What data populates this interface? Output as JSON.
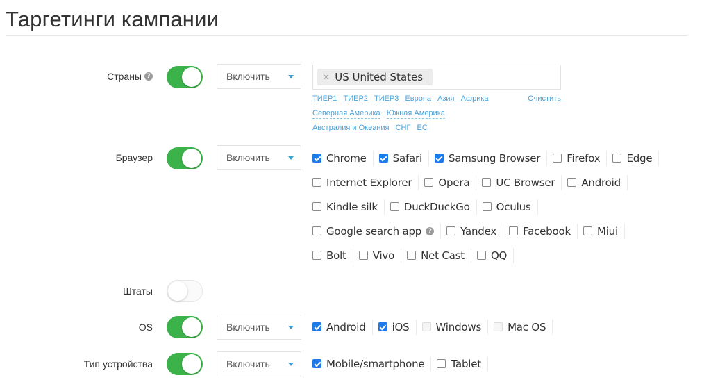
{
  "page": {
    "title": "Таргетинги кампании"
  },
  "countries": {
    "label": "Страны",
    "has_help": true,
    "toggle_on": true,
    "mode": "Включить",
    "selected_tags": [
      {
        "code": "US",
        "name": "US United States"
      }
    ],
    "quick_links": [
      [
        "ТИЕР1",
        "ТИЕР2",
        "ТИЕР3",
        "Европа",
        "Азия",
        "Африка"
      ],
      [
        "Северная Америка",
        "Южная Америка"
      ],
      [
        "Австралия и Океания",
        "СНГ",
        "ЕС"
      ]
    ],
    "clear_label": "Очистить"
  },
  "browser": {
    "label": "Браузер",
    "toggle_on": true,
    "mode": "Включить",
    "rows": [
      [
        {
          "label": "Chrome",
          "checked": true
        },
        {
          "label": "Safari",
          "checked": true
        },
        {
          "label": "Samsung Browser",
          "checked": true
        },
        {
          "label": "Firefox",
          "checked": false
        },
        {
          "label": "Edge",
          "checked": false
        }
      ],
      [
        {
          "label": "Internet Explorer",
          "checked": false
        },
        {
          "label": "Opera",
          "checked": false
        },
        {
          "label": "UC Browser",
          "checked": false
        },
        {
          "label": "Android",
          "checked": false
        }
      ],
      [
        {
          "label": "Kindle silk",
          "checked": false
        },
        {
          "label": "DuckDuckGo",
          "checked": false
        },
        {
          "label": "Oculus",
          "checked": false
        }
      ],
      [
        {
          "label": "Google search app",
          "checked": false,
          "help": true
        },
        {
          "label": "Yandex",
          "checked": false
        },
        {
          "label": "Facebook",
          "checked": false
        },
        {
          "label": "Miui",
          "checked": false
        }
      ],
      [
        {
          "label": "Bolt",
          "checked": false
        },
        {
          "label": "Vivo",
          "checked": false
        },
        {
          "label": "Net Cast",
          "checked": false
        },
        {
          "label": "QQ",
          "checked": false
        }
      ]
    ]
  },
  "states": {
    "label": "Штаты",
    "toggle_on": false
  },
  "os": {
    "label": "OS",
    "toggle_on": true,
    "mode": "Включить",
    "options": [
      {
        "label": "Android",
        "checked": true
      },
      {
        "label": "iOS",
        "checked": true
      },
      {
        "label": "Windows",
        "checked": false,
        "disabled": true
      },
      {
        "label": "Mac OS",
        "checked": false,
        "disabled": true
      }
    ]
  },
  "device_type": {
    "label": "Тип устройства",
    "toggle_on": true,
    "mode": "Включить",
    "options": [
      {
        "label": "Mobile/smartphone",
        "checked": true
      },
      {
        "label": "Tablet",
        "checked": false
      }
    ]
  },
  "colors": {
    "toggle_on": "#3cb34a",
    "checkbox_checked": "#1e7ae8",
    "link": "#4aa3d8",
    "caret": "#3d9bd6"
  }
}
